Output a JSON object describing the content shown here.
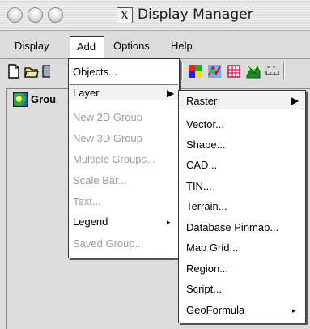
{
  "window": {
    "title": "Display Manager",
    "app_icon_glyph": "X"
  },
  "menubar": {
    "display": "Display",
    "add": "Add",
    "options": "Options",
    "help": "Help"
  },
  "tree": {
    "group_label": "Grou"
  },
  "add_menu": {
    "objects": "Objects...",
    "layer": "Layer",
    "new_2d_group": "New 2D Group",
    "new_3d_group": "New 3D Group",
    "multiple_groups": "Multiple Groups...",
    "scale_bar": "Scale Bar...",
    "text": "Text...",
    "legend": "Legend",
    "saved_group": "Saved Group..."
  },
  "layer_menu": {
    "raster": "Raster",
    "vector": "Vector...",
    "shape": "Shape...",
    "cad": "CAD...",
    "tin": "TIN...",
    "terrain": "Terrain...",
    "database_pinmap": "Database Pinmap...",
    "map_grid": "Map Grid...",
    "region": "Region...",
    "script": "Script...",
    "geoformula": "GeoFormula"
  },
  "glyphs": {
    "submenu_arrow": "▸",
    "raster_arrow": "▶"
  },
  "colors": {
    "menu_background": "#dcdcdc",
    "popup_background": "#ffffff",
    "disabled_text": "#9c9c9c"
  }
}
